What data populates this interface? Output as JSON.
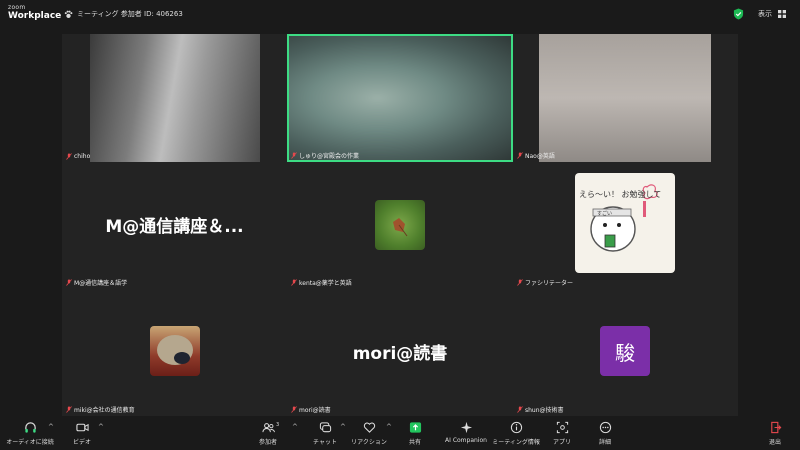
{
  "app": {
    "brand_small": "zoom",
    "brand_big": "Workplace"
  },
  "header": {
    "meeting_label": "ミーティング 参加者 ID: 406263",
    "view_label": "表示"
  },
  "tiles": [
    {
      "name": "chiho",
      "type": "video"
    },
    {
      "name": "しゅり@宮殿会の作業",
      "type": "video",
      "speaking": true
    },
    {
      "name": "Nao@英語",
      "type": "video"
    },
    {
      "name": "M@通信講座＆語学",
      "type": "name",
      "display": "M@通信講座＆..."
    },
    {
      "name": "kenta@薬学と英語",
      "type": "avatar",
      "avatar": "leaf-avatar"
    },
    {
      "name": "ファシリテーター",
      "type": "avatar",
      "avatar": "illustration-avatar",
      "avatar_text": "えら～い！ お勉強して",
      "avatar_badge": "すごい"
    },
    {
      "name": "miki@会社の通信教育",
      "type": "avatar",
      "avatar": "hedgehog-avatar"
    },
    {
      "name": "mori@読書",
      "type": "name",
      "display": "mori@読書"
    },
    {
      "name": "shun@技術書",
      "type": "avatar",
      "avatar_char": "駿",
      "avatar_color": "#7b2fa8"
    }
  ],
  "toolbar": {
    "audio": "オーディオに接続",
    "video": "ビデオ",
    "participants": "参加者",
    "participants_count": "3",
    "chat": "チャット",
    "reactions": "リアクション",
    "share": "共有",
    "ai": "AI Companion",
    "info": "ミーティング情報",
    "apps": "アプリ",
    "more": "詳細",
    "leave": "退出"
  },
  "colors": {
    "accent_green": "#3ddc84",
    "share_green": "#22c55e",
    "leave_red": "#e5484d"
  }
}
